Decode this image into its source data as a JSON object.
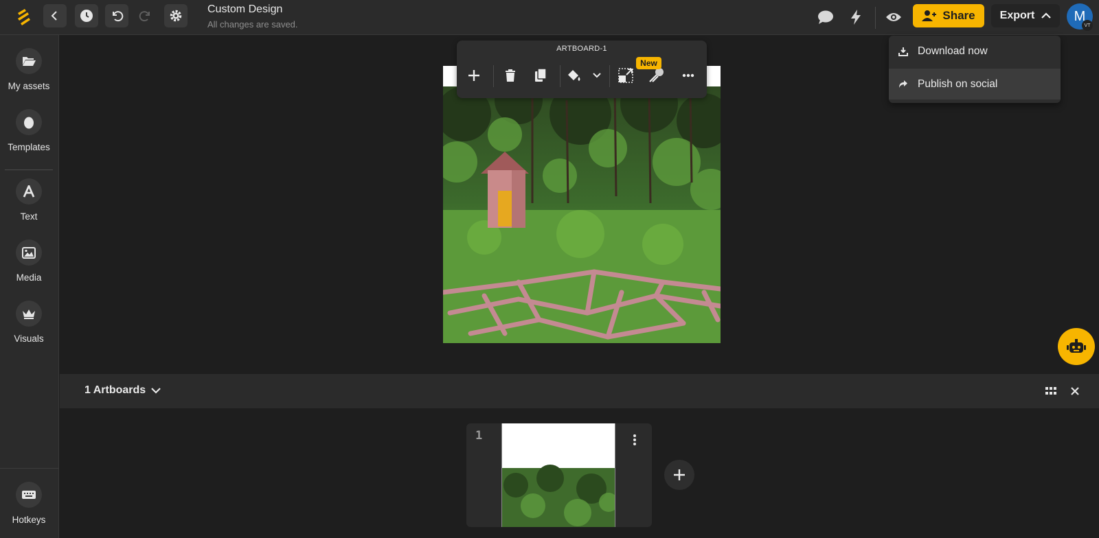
{
  "header": {
    "doc_title": "Custom Design",
    "doc_status": "All changes are saved.",
    "share_label": "Share",
    "export_label": "Export",
    "avatar_initial": "M",
    "avatar_badge": "VT"
  },
  "export_menu": {
    "items": [
      {
        "label": "Download now",
        "icon": "download-icon"
      },
      {
        "label": "Publish on social",
        "icon": "share-arrow-icon"
      }
    ]
  },
  "sidebar": {
    "items": [
      {
        "label": "My assets",
        "icon": "folder-icon"
      },
      {
        "label": "Templates",
        "icon": "egg-icon"
      },
      {
        "label": "Text",
        "icon": "text-icon"
      },
      {
        "label": "Media",
        "icon": "image-icon"
      },
      {
        "label": "Visuals",
        "icon": "crown-icon"
      }
    ],
    "hotkeys_label": "Hotkeys"
  },
  "artboard_toolbar": {
    "title": "ARTBOARD-1",
    "new_badge": "New"
  },
  "artboards_panel": {
    "label": "1 Artboards",
    "thumbnails": [
      {
        "number": "1"
      }
    ]
  },
  "colors": {
    "accent": "#f7b500",
    "avatar": "#1f6bb8",
    "topbar": "#2b2b2b",
    "canvas": "#1e1e1e"
  }
}
